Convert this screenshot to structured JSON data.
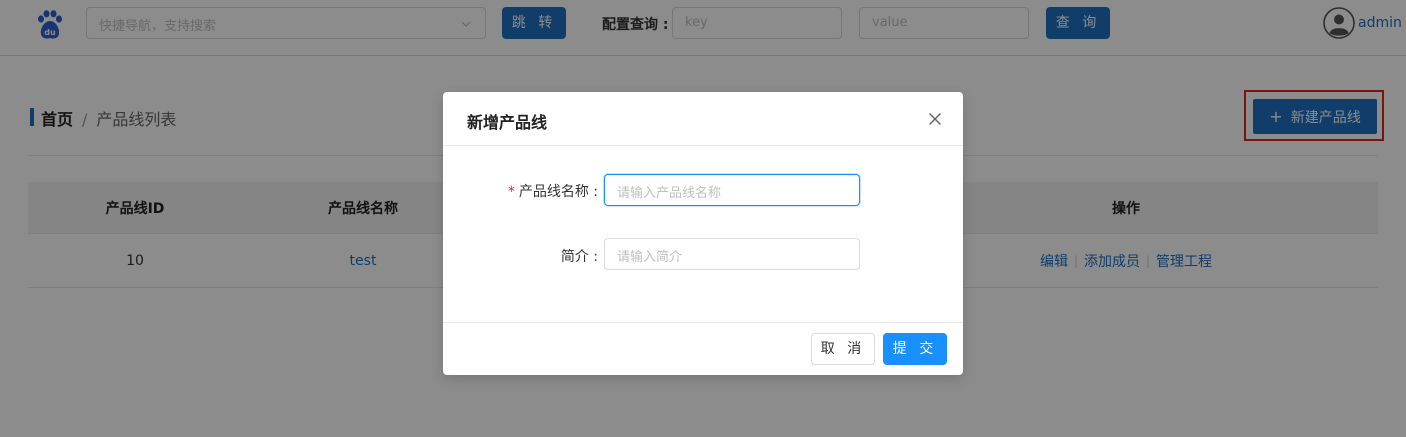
{
  "header": {
    "logo": "baidu-paw-logo",
    "nav_placeholder": "快捷导航，支持搜索",
    "jump_label": "跳 转",
    "query_label": "配置查询 :",
    "key_placeholder": "key",
    "value_placeholder": "value",
    "query_button": "查 询",
    "username": "admin",
    "brand_color": "#1e6fc0"
  },
  "breadcrumb": {
    "home": "首页",
    "separator": "/",
    "current": "产品线列表"
  },
  "toolbar": {
    "new_button_icon": "+",
    "new_button_label": "新建产品线"
  },
  "table": {
    "headers": [
      "产品线ID",
      "产品线名称",
      "操作"
    ],
    "rows": [
      {
        "id": "10",
        "name": "test",
        "actions": [
          "编辑",
          "添加成员",
          "管理工程"
        ]
      }
    ]
  },
  "modal": {
    "title": "新增产品线",
    "fields": [
      {
        "label": "产品线名称 :",
        "required": true,
        "required_mark": "*",
        "placeholder": "请输入产品线名称"
      },
      {
        "label": "简介 :",
        "required": false,
        "placeholder": "请输入简介"
      }
    ],
    "cancel_label": "取 消",
    "submit_label": "提 交"
  }
}
